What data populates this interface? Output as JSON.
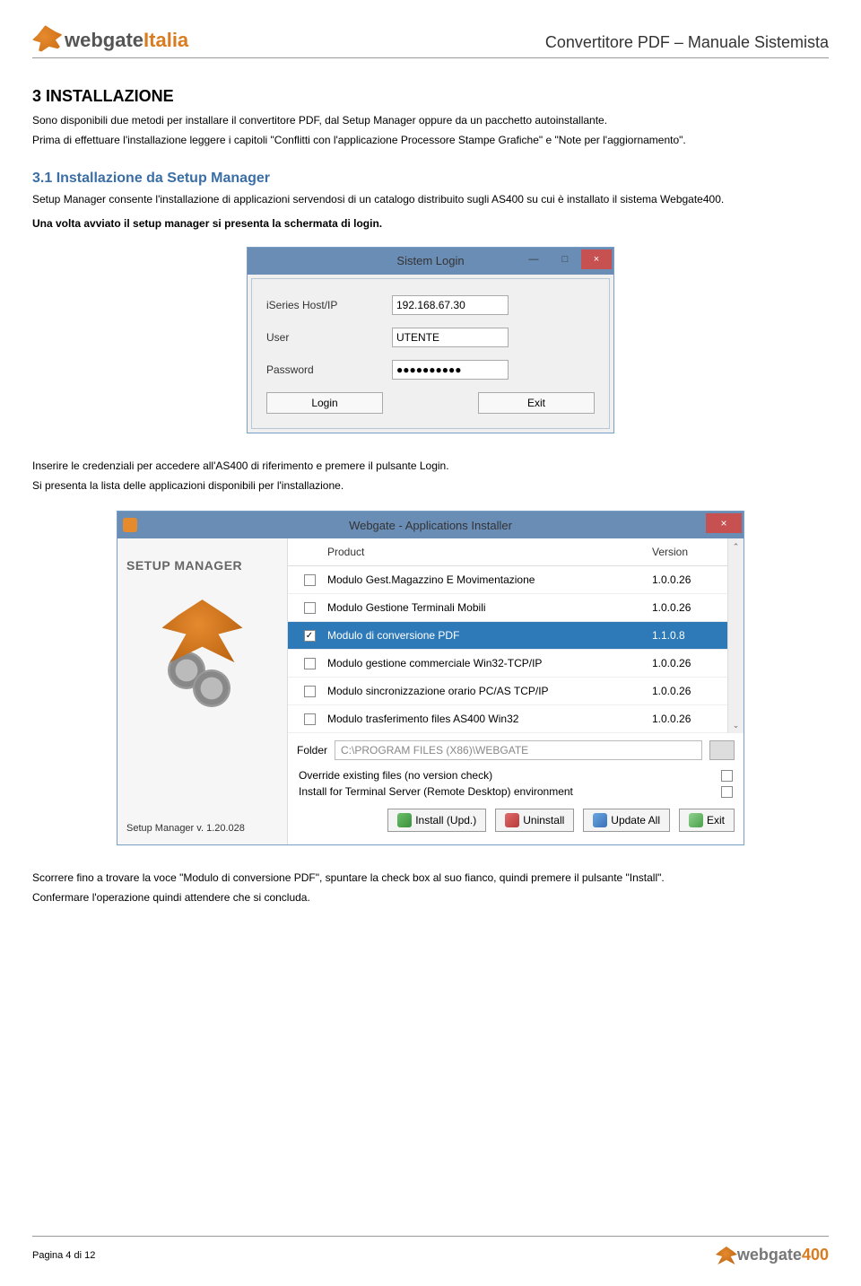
{
  "header": {
    "logo_a": "webgate",
    "logo_b": "Italia",
    "doc_title": "Convertitore PDF – Manuale Sistemista"
  },
  "section": {
    "num_title": "3  INSTALLAZIONE",
    "intro1": "Sono disponibili due metodi per installare il convertitore PDF, dal Setup Manager oppure da un pacchetto autoinstallante.",
    "intro2": "Prima di effettuare l'installazione leggere i capitoli \"Conflitti con l'applicazione Processore Stampe Grafiche\" e \"Note per l'aggiornamento\"."
  },
  "subsection": {
    "title": "3.1  Installazione da Setup Manager",
    "p1": "Setup Manager consente l'installazione di applicazioni servendosi di un catalogo distribuito sugli AS400 su cui è installato il sistema Webgate400.",
    "p2": "Una volta avviato il setup manager si presenta la schermata di login."
  },
  "login": {
    "title": "Sistem Login",
    "host_label": "iSeries Host/IP",
    "host_value": "192.168.67.30",
    "user_label": "User",
    "user_value": "UTENTE",
    "pwd_label": "Password",
    "pwd_value": "●●●●●●●●●●",
    "login_btn": "Login",
    "exit_btn": "Exit",
    "min": "—",
    "max": "□",
    "close": "×"
  },
  "after_login": {
    "p1": "Inserire le credenziali per accedere all'AS400 di riferimento e premere il pulsante Login.",
    "p2": "Si presenta la lista delle applicazioni disponibili per l'installazione."
  },
  "installer": {
    "title": "Webgate - Applications Installer",
    "close": "×",
    "side_brand": "SETUP MANAGER",
    "side_version": "Setup Manager v. 1.20.028",
    "col_product": "Product",
    "col_version": "Version",
    "rows": [
      {
        "checked": false,
        "product": "Modulo Gest.Magazzino E Movimentazione",
        "version": "1.0.0.26",
        "selected": false
      },
      {
        "checked": false,
        "product": "Modulo Gestione Terminali Mobili",
        "version": "1.0.0.26",
        "selected": false
      },
      {
        "checked": true,
        "product": "Modulo di conversione PDF",
        "version": "1.1.0.8",
        "selected": true
      },
      {
        "checked": false,
        "product": "Modulo gestione commerciale Win32-TCP/IP",
        "version": "1.0.0.26",
        "selected": false
      },
      {
        "checked": false,
        "product": "Modulo sincronizzazione orario PC/AS TCP/IP",
        "version": "1.0.0.26",
        "selected": false
      },
      {
        "checked": false,
        "product": "Modulo trasferimento files AS400 Win32",
        "version": "1.0.0.26",
        "selected": false
      }
    ],
    "folder_label": "Folder",
    "folder_value": "C:\\PROGRAM FILES (X86)\\WEBGATE",
    "opt_override": "Override existing files (no version check)",
    "opt_terminal": "Install for Terminal Server (Remote Desktop) environment",
    "btn_install": "Install (Upd.)",
    "btn_uninstall": "Uninstall",
    "btn_update": "Update All",
    "btn_exit": "Exit",
    "scroll_up": "⌃",
    "scroll_down": "⌄"
  },
  "tail": {
    "p1": "Scorrere fino a trovare la voce \"Modulo di conversione PDF\", spuntare la check box al suo fianco, quindi premere il pulsante \"Install\".",
    "p2": "Confermare l'operazione quindi attendere che si concluda."
  },
  "footer": {
    "page": "Pagina 4 di 12",
    "logo_a": "webgate",
    "logo_b": "400"
  }
}
